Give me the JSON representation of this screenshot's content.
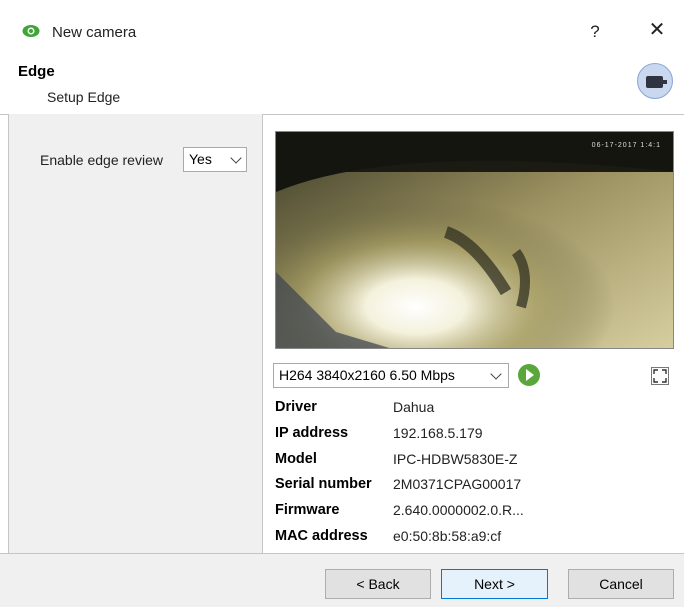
{
  "window": {
    "title": "New camera",
    "help_label": "?",
    "close_label": "✕"
  },
  "header": {
    "title": "Edge",
    "subtitle": "Setup Edge"
  },
  "settings": {
    "enable_edge_review_label": "Enable edge review",
    "enable_edge_review_value": "Yes"
  },
  "preview": {
    "osd_text": "06-17-2017 1:4:1",
    "stream_selected": "H264 3840x2160 6.50 Mbps"
  },
  "info": [
    {
      "label": "Driver",
      "value": "Dahua"
    },
    {
      "label": "IP address",
      "value": "192.168.5.179"
    },
    {
      "label": "Model",
      "value": "IPC-HDBW5830E-Z"
    },
    {
      "label": "Serial number",
      "value": "2M0371CPAG00017"
    },
    {
      "label": "Firmware",
      "value": "2.640.0000002.0.R..."
    },
    {
      "label": "MAC address",
      "value": "e0:50:8b:58:a9:cf"
    }
  ],
  "footer": {
    "back_label": "< Back",
    "next_label": "Next >",
    "cancel_label": "Cancel"
  },
  "colors": {
    "accent": "#0078d7",
    "eye_icon": "#3fa535",
    "play_icon": "#5aa63a",
    "panel_bg": "#f0f0f0"
  },
  "icons": {
    "title": "eye-icon",
    "badge": "camera-icon",
    "play": "play-icon",
    "fullscreen": "fullscreen-icon"
  }
}
